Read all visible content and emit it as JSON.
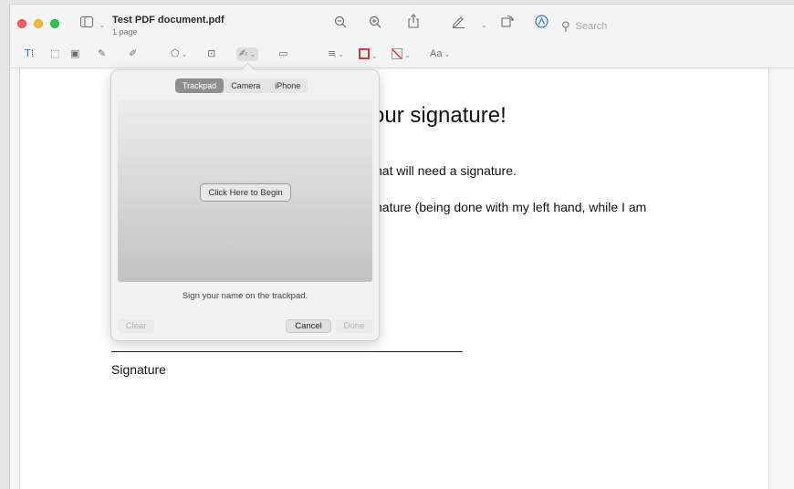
{
  "window": {
    "title": "Test PDF document.pdf",
    "subtitle": "1 page"
  },
  "toolbar": {
    "search_placeholder": "Search",
    "icons": [
      "sidebar-icon",
      "zoom-out-icon",
      "zoom-in-icon",
      "share-icon",
      "pen-icon",
      "rotate-icon",
      "markup-icon",
      "search-icon"
    ]
  },
  "markup": {
    "text_size_label": "Aa",
    "border_color": "#d63a2f"
  },
  "page": {
    "heading": "our signature!",
    "line1": "hat will need a signature.",
    "line2": "nature (being done with my left hand, while I am",
    "signature_label": "Signature"
  },
  "signature_popover": {
    "tabs": [
      "Trackpad",
      "Camera",
      "iPhone"
    ],
    "active_tab": "Trackpad",
    "begin_button": "Click Here to Begin",
    "hint": "Sign your name on the trackpad.",
    "clear_label": "Clear",
    "cancel_label": "Cancel",
    "done_label": "Done"
  }
}
